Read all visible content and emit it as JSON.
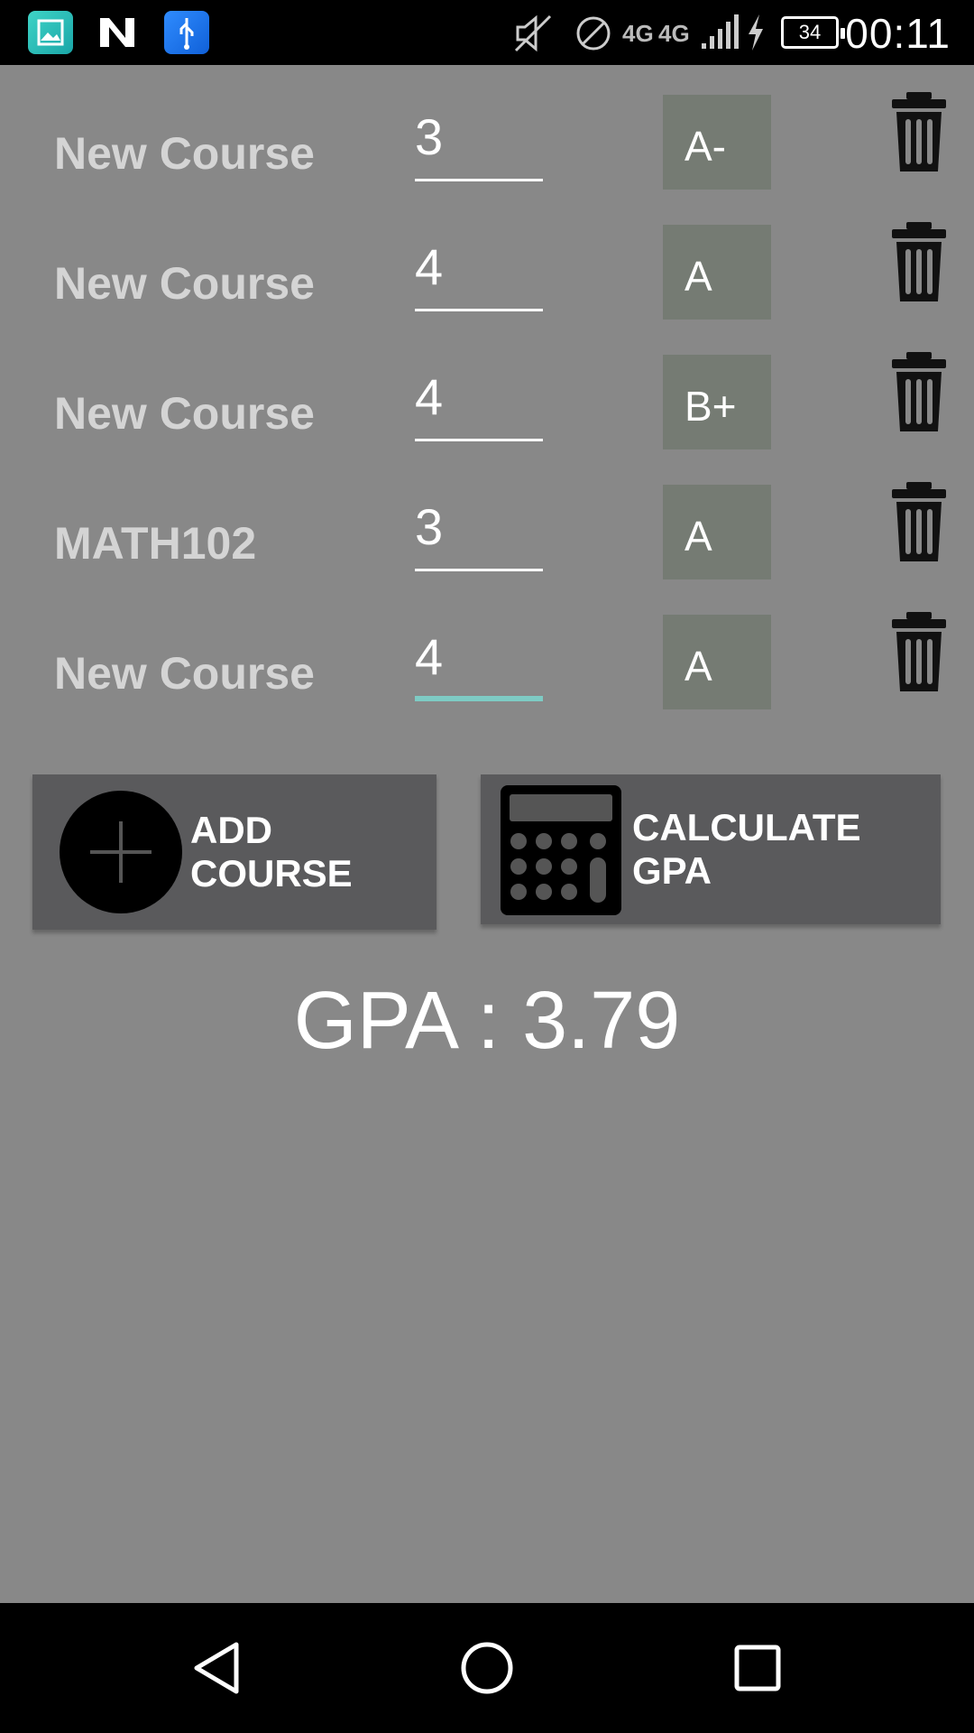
{
  "status_bar": {
    "time": "00:11",
    "battery": "34",
    "network_1": "4G",
    "network_2": "4G",
    "icons": [
      "gallery-icon",
      "n-icon",
      "usb-icon",
      "mute-icon",
      "do-not-disturb-icon",
      "signal-icon",
      "charging-icon",
      "battery-icon"
    ]
  },
  "courses": [
    {
      "name": "New Course",
      "credits": "3",
      "grade": "A-"
    },
    {
      "name": "New Course",
      "credits": "4",
      "grade": "A"
    },
    {
      "name": "New Course",
      "credits": "4",
      "grade": "B+"
    },
    {
      "name": "MATH102",
      "credits": "3",
      "grade": "A"
    },
    {
      "name": "New Course",
      "credits": "4",
      "grade": "A"
    }
  ],
  "actions": {
    "add_label": "ADD COURSE",
    "calculate_label": "CALCULATE GPA"
  },
  "result": {
    "gpa_text": "GPA : 3.79"
  },
  "colors": {
    "background": "#888888",
    "grade_box": "#757b73",
    "button": "#5a5a5c",
    "focus_accent": "#7ecbc4"
  }
}
